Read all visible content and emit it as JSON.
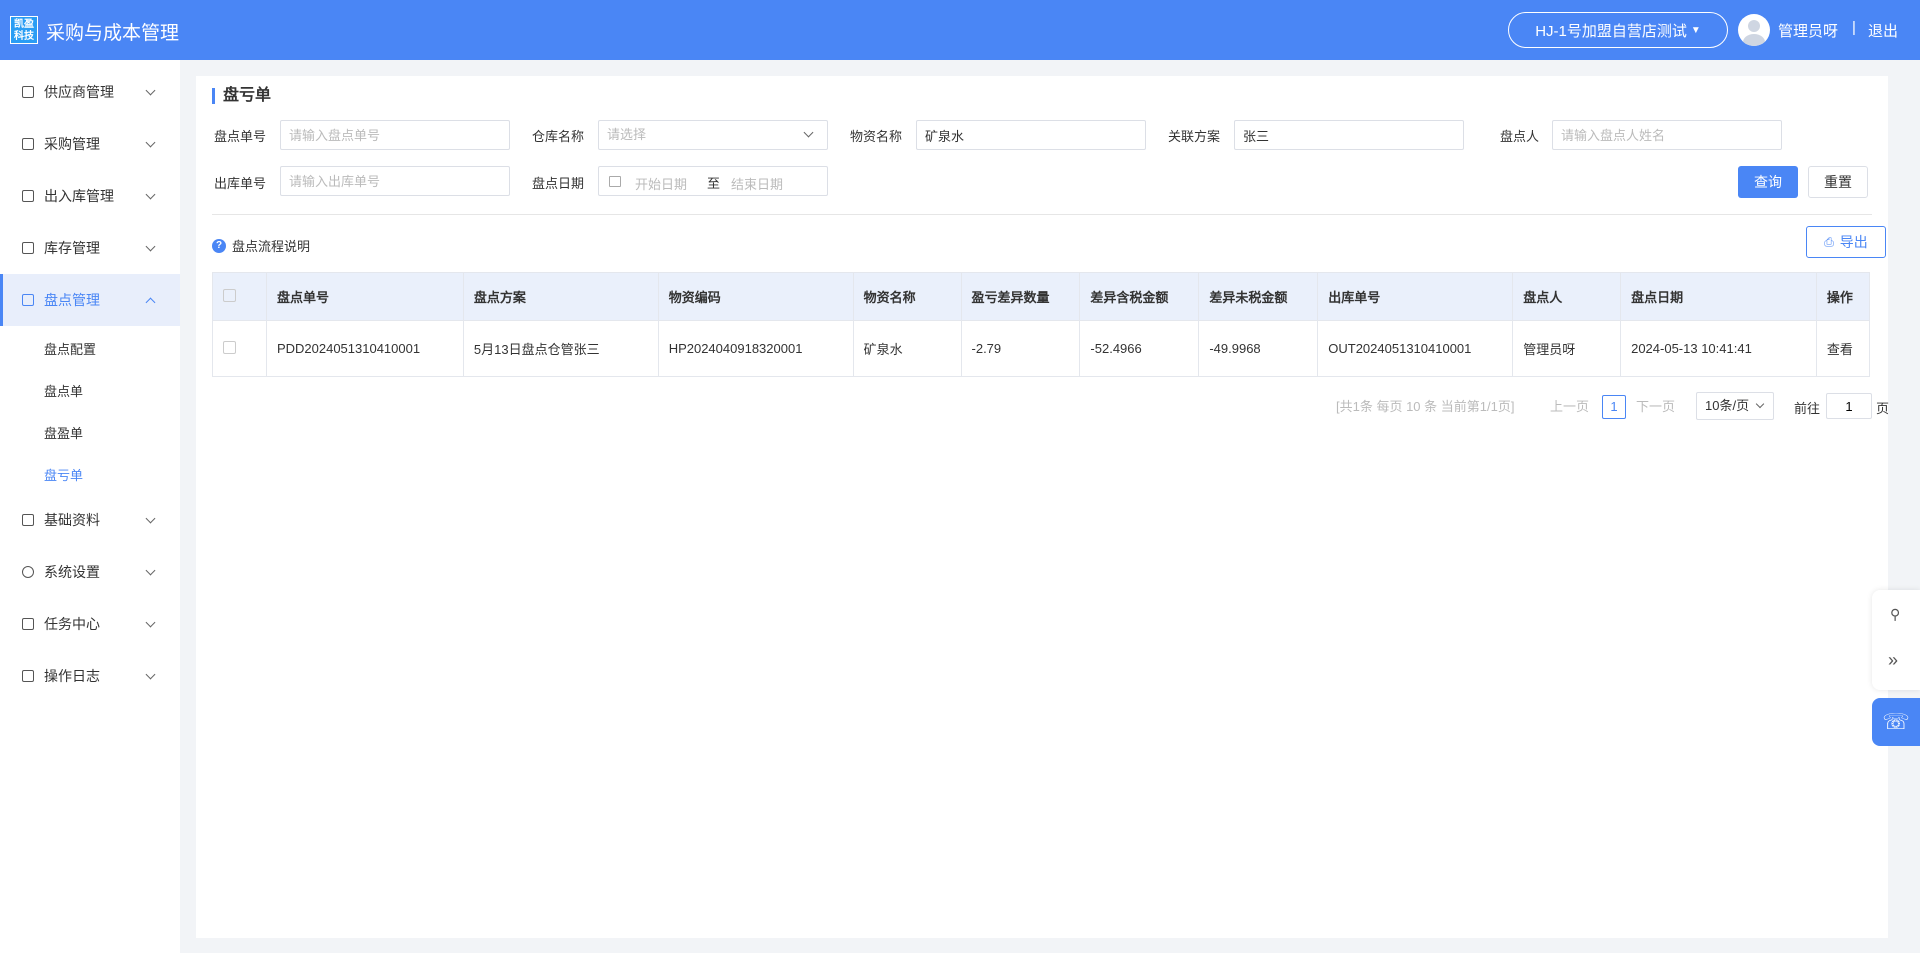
{
  "header": {
    "logo_line1": "凯盈",
    "logo_line2": "科技",
    "app_title": "采购与成本管理",
    "store": "HJ-1号加盟自营店测试",
    "user": "管理员呀",
    "separator": "|",
    "logout": "退出"
  },
  "sidebar": {
    "items": [
      {
        "label": "供应商管理"
      },
      {
        "label": "采购管理"
      },
      {
        "label": "出入库管理"
      },
      {
        "label": "库存管理"
      },
      {
        "label": "盘点管理"
      },
      {
        "label": "基础资料"
      },
      {
        "label": "系统设置"
      },
      {
        "label": "任务中心"
      },
      {
        "label": "操作日志"
      }
    ],
    "sub_items": [
      {
        "label": "盘点配置"
      },
      {
        "label": "盘点单"
      },
      {
        "label": "盘盈单"
      },
      {
        "label": "盘亏单"
      }
    ]
  },
  "page": {
    "title": "盘亏单"
  },
  "filters": {
    "check_no_label": "盘点单号",
    "check_no_placeholder": "请输入盘点单号",
    "warehouse_label": "仓库名称",
    "warehouse_placeholder": "请选择",
    "material_label": "物资名称",
    "material_value": "矿泉水",
    "plan_label": "关联方案",
    "plan_value": "张三",
    "checker_label": "盘点人",
    "checker_placeholder": "请输入盘点人姓名",
    "out_no_label": "出库单号",
    "out_no_placeholder": "请输入出库单号",
    "date_label": "盘点日期",
    "date_start": "开始日期",
    "date_to": "至",
    "date_end": "结束日期",
    "query": "查询",
    "reset": "重置"
  },
  "help_text": "盘点流程说明",
  "export_label": "导出",
  "table": {
    "headers": [
      "盘点单号",
      "盘点方案",
      "物资编码",
      "物资名称",
      "盈亏差异数量",
      "差异含税金额",
      "差异未税金额",
      "出库单号",
      "盘点人",
      "盘点日期",
      "操作"
    ],
    "rows": [
      [
        "PDD2024051310410001",
        "5月13日盘点仓管张三",
        "HP2024040918320001",
        "矿泉水",
        "-2.79",
        "-52.4966",
        "-49.9968",
        "OUT2024051310410001",
        "管理员呀",
        "2024-05-13 10:41:41",
        "查看"
      ]
    ]
  },
  "pager": {
    "summary": "[共1条 每页 10 条 当前第1/1页]",
    "prev": "上一页",
    "current": "1",
    "next": "下一页",
    "page_size": "10条/页",
    "goto_label": "前往",
    "goto_value": "1",
    "page_unit": "页"
  },
  "colors": {
    "primary": "#4a86f5"
  }
}
